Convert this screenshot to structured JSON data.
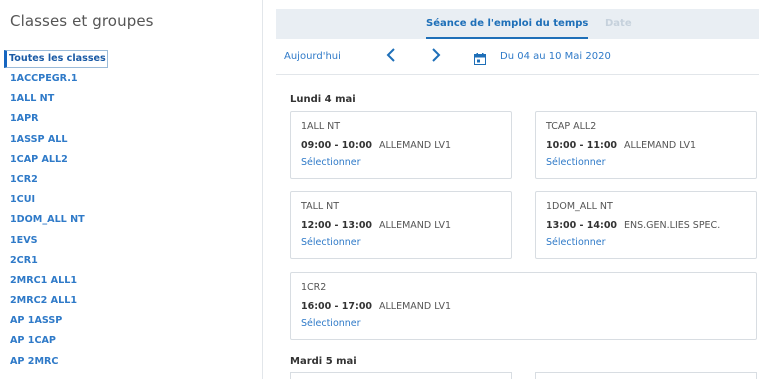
{
  "sidebar": {
    "title": "Classes et groupes",
    "items": [
      {
        "label": "Toutes les classes"
      },
      {
        "label": "1ACCPEGR.1"
      },
      {
        "label": "1ALL NT"
      },
      {
        "label": "1APR"
      },
      {
        "label": "1ASSP ALL"
      },
      {
        "label": "1CAP ALL2"
      },
      {
        "label": "1CR2"
      },
      {
        "label": "1CUI"
      },
      {
        "label": "1DOM_ALL NT"
      },
      {
        "label": "1EVS"
      },
      {
        "label": "2CR1"
      },
      {
        "label": "2MRC1 ALL1"
      },
      {
        "label": "2MRC2 ALL1"
      },
      {
        "label": "AP 1ASSP"
      },
      {
        "label": "AP 1CAP"
      },
      {
        "label": "AP 2MRC"
      }
    ]
  },
  "tabs": {
    "active": "Séance de l'emploi du temps",
    "inactive": "Date"
  },
  "toolbar": {
    "today": "Aujourd'hui",
    "prev_icon": "chevron-left-icon",
    "next_icon": "chevron-right-icon",
    "calendar_icon": "calendar-icon",
    "date_range": "Du 04 au 10 Mai 2020"
  },
  "days": [
    {
      "heading": "Lundi 4 mai",
      "sessions": [
        {
          "class": "1ALL NT",
          "time": "09:00 - 10:00",
          "subject": "ALLEMAND LV1",
          "action": "Sélectionner"
        },
        {
          "class": "TCAP ALL2",
          "time": "10:00 - 11:00",
          "subject": "ALLEMAND LV1",
          "action": "Sélectionner"
        },
        {
          "class": "TALL NT",
          "time": "12:00 - 13:00",
          "subject": "ALLEMAND LV1",
          "action": "Sélectionner"
        },
        {
          "class": "1DOM_ALL NT",
          "time": "13:00 - 14:00",
          "subject": "ENS.GEN.LIES SPEC.",
          "action": "Sélectionner"
        },
        {
          "class": "1CR2",
          "time": "16:00 - 17:00",
          "subject": "ALLEMAND LV1",
          "action": "Sélectionner"
        }
      ]
    },
    {
      "heading": "Mardi 5 mai",
      "sessions": []
    }
  ],
  "colors": {
    "accent": "#1e6fb8",
    "link": "#2f7ac8",
    "tabbar_bg": "#e9eef3",
    "border": "#d8dde2"
  }
}
